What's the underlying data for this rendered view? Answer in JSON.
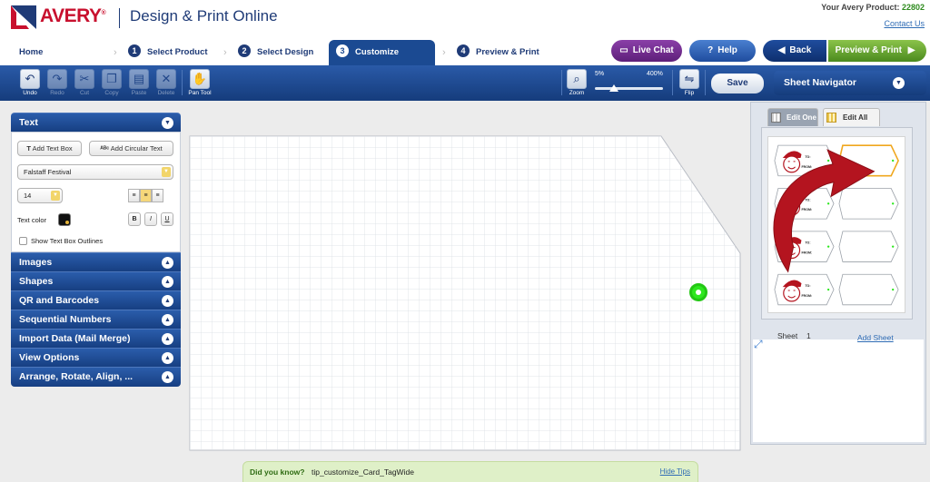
{
  "header": {
    "brand": "AVERY",
    "app_title": "Design & Print Online",
    "product_label": "Your Avery Product:",
    "product_number": "22802",
    "contact_link": "Contact Us"
  },
  "steps": [
    {
      "label": "Home"
    },
    {
      "num": "1",
      "label": "Select Product"
    },
    {
      "num": "2",
      "label": "Select Design"
    },
    {
      "num": "3",
      "label": "Customize",
      "active": true
    },
    {
      "num": "4",
      "label": "Preview & Print"
    }
  ],
  "actions": {
    "live_chat": "Live Chat",
    "help": "Help",
    "back": "Back",
    "preview_print": "Preview & Print"
  },
  "toolbar": {
    "undo": "Undo",
    "redo": "Redo",
    "cut": "Cut",
    "copy": "Copy",
    "paste": "Paste",
    "delete": "Delete",
    "pan_tool": "Pan Tool",
    "zoom": "Zoom",
    "zoom_min": "5%",
    "zoom_max": "400%",
    "zoom_level_fraction": 0.28,
    "flip": "Flip",
    "save": "Save"
  },
  "sheet_navigator": {
    "title": "Sheet Navigator",
    "tab_edit_one": "Edit One",
    "tab_edit_all": "Edit All",
    "sheet_label": "Sheet",
    "sheet_number": "1",
    "add_sheet": "Add Sheet",
    "tag_to": "TO:",
    "tag_from": "FROM:"
  },
  "left_panel": {
    "text_section": "Text",
    "add_text_box": "Add Text Box",
    "add_circular_text": "Add Circular Text",
    "font": "Falstaff Festival",
    "font_size": "14",
    "text_color_label": "Text color",
    "bold": "B",
    "italic": "I",
    "underline": "U",
    "show_outlines": "Show Text Box Outlines",
    "sections": [
      "Images",
      "Shapes",
      "QR and Barcodes",
      "Sequential Numbers",
      "Import Data (Mail Merge)",
      "View Options",
      "Arrange, Rotate, Align, ..."
    ]
  },
  "tips": {
    "did_you_know": "Did you know?",
    "tip": "tip_customize_Card_TagWide",
    "hide_tips": "Hide Tips"
  },
  "colors": {
    "brand_blue": "#1f3b77",
    "avery_red": "#c8102e",
    "live_chat": "#6a2a88",
    "preview_green": "#5a9c2a",
    "selection_orange": "#f0a71e",
    "santa_red": "#b4141f",
    "marker_green": "#2ee81f"
  }
}
